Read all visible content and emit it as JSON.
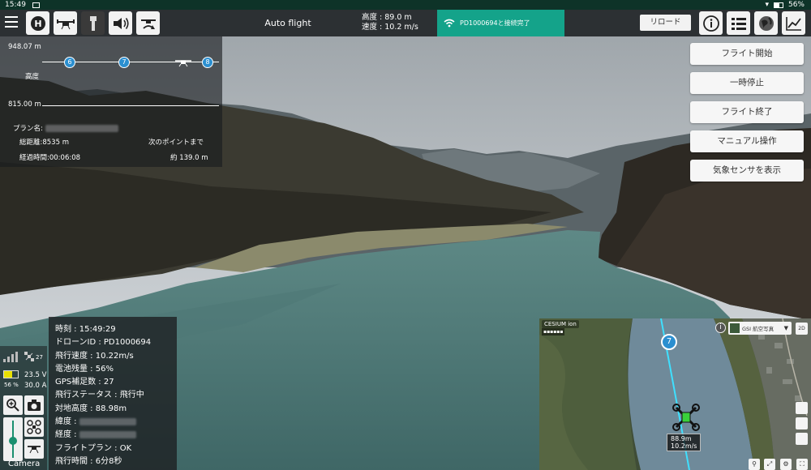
{
  "system": {
    "time": "15:49",
    "battery_pct": "56%"
  },
  "toolbar": {
    "mode": "Auto flight",
    "altitude": "高度 : 89.0 m",
    "speed": "速度 : 10.2 m/s",
    "connection": "PD1000694と接続完了",
    "reload": "リロード",
    "icons": [
      "menu-icon",
      "helipad-icon",
      "drone-icon",
      "flashlight-icon",
      "speaker-icon",
      "drone-return-icon",
      "info-icon",
      "list-icon",
      "globe-icon",
      "chart-icon"
    ]
  },
  "actions": [
    "フライト開始",
    "一時停止",
    "フライト終了",
    "マニュアル操作",
    "気象センサを表示"
  ],
  "profile": {
    "max_alt": "948.07 m",
    "min_alt": "815.00 m",
    "alt_label": "高度",
    "waypoints": [
      "6",
      "7",
      "8"
    ],
    "plan_label": "プラン名:",
    "total_distance": "総距離:8535 m",
    "next_point_label": "次のポイントまで",
    "elapsed": "経過時間:00:06:08",
    "next_point_value": "約 139.0 m"
  },
  "telemetry": {
    "gps_count": "27",
    "voltage": "23.5 V",
    "battery_pct": "56 %",
    "current": "30.0 A",
    "battery_level": 0.56,
    "zoom_level": 0.45,
    "camera_label": "Camera"
  },
  "status": {
    "time": "時刻 : 15:49:29",
    "drone_id": "ドローンID : PD1000694",
    "speed": "飛行速度 : 10.22m/s",
    "battery": "電池残量 : 56%",
    "gps": "GPS補足数 : 27",
    "flight_status": "飛行ステータス : 飛行中",
    "ground_alt": "対地高度 : 88.98m",
    "lat_label": "緯度 :",
    "lon_label": "経度 :",
    "flight_plan": "フライトプラン : OK",
    "flight_time": "飛行時間 : 6分8秒"
  },
  "map": {
    "brand": "CESIUM ion",
    "layer": "GSI 航空写真",
    "waypoint": "7",
    "drone_alt": "88.9m",
    "drone_speed": "10.2m/s",
    "layer_btn": "2D"
  }
}
